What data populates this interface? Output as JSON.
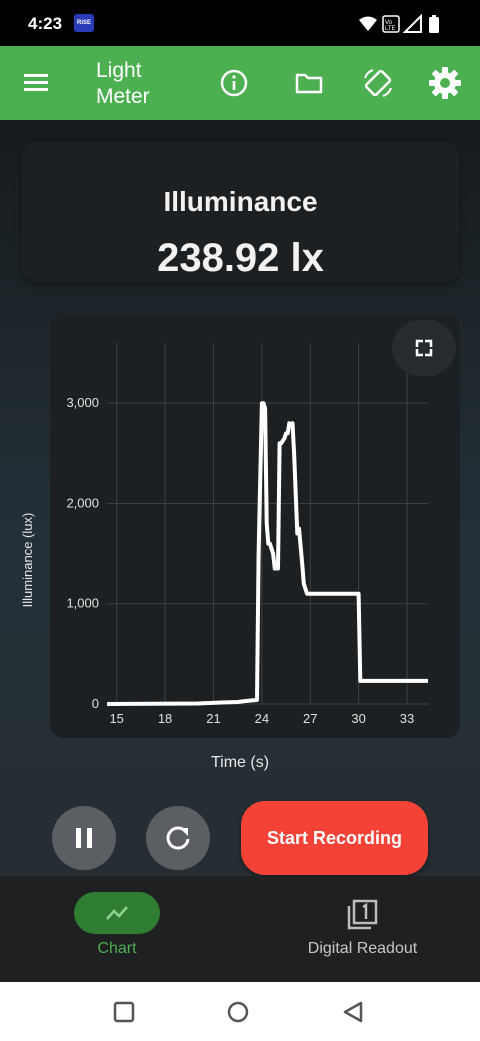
{
  "status_bar": {
    "time": "4:23",
    "badge": "RiSE"
  },
  "app_bar": {
    "title": "Light Meter",
    "icons": [
      "menu-icon",
      "info-icon",
      "folder-icon",
      "screen-rotation-icon",
      "settings-gear-icon"
    ]
  },
  "readout": {
    "label": "Illuminance",
    "value": "238.92 lx"
  },
  "chart_data": {
    "type": "line",
    "xlabel": "Time (s)",
    "ylabel": "Illuminance (lux)",
    "x_ticks": [
      "15",
      "18",
      "21",
      "24",
      "27",
      "30",
      "33"
    ],
    "y_ticks": [
      "0",
      "1,000",
      "2,000",
      "3,000"
    ],
    "xlim": [
      14.4,
      34.3
    ],
    "ylim": [
      0,
      3600
    ],
    "grid": true,
    "line_color": "#ffffff",
    "series": [
      {
        "x": [
          14.4,
          20.0,
          21.5,
          22.5,
          23.0,
          23.7,
          23.8,
          24.0,
          24.1,
          24.2,
          24.3,
          24.4,
          24.5,
          24.7,
          24.8,
          24.9,
          25.0,
          25.1,
          25.2,
          25.4,
          25.5,
          25.6,
          25.7,
          25.8,
          25.9,
          26.0,
          26.2,
          26.3,
          26.5,
          26.6,
          26.8,
          27.0,
          27.5,
          28.5,
          29.5,
          29.9,
          30.0,
          30.1,
          31.0,
          32.0,
          34.3
        ],
        "y": [
          0,
          5,
          15,
          20,
          30,
          40,
          1500,
          3000,
          3000,
          2950,
          1800,
          1600,
          1600,
          1500,
          1350,
          1400,
          1350,
          2600,
          2600,
          2650,
          2700,
          2700,
          2800,
          2780,
          2800,
          2500,
          1700,
          1750,
          1400,
          1200,
          1100,
          1100,
          1100,
          1100,
          1100,
          1100,
          1100,
          230,
          230,
          230,
          230
        ]
      }
    ]
  },
  "controls": {
    "record_label": "Start Recording"
  },
  "bottom_nav": {
    "chart_label": "Chart",
    "readout_label": "Digital Readout"
  },
  "colors": {
    "app_bar": "#4caf50",
    "record_button": "#f44336",
    "nav_active": "#4caf50"
  }
}
